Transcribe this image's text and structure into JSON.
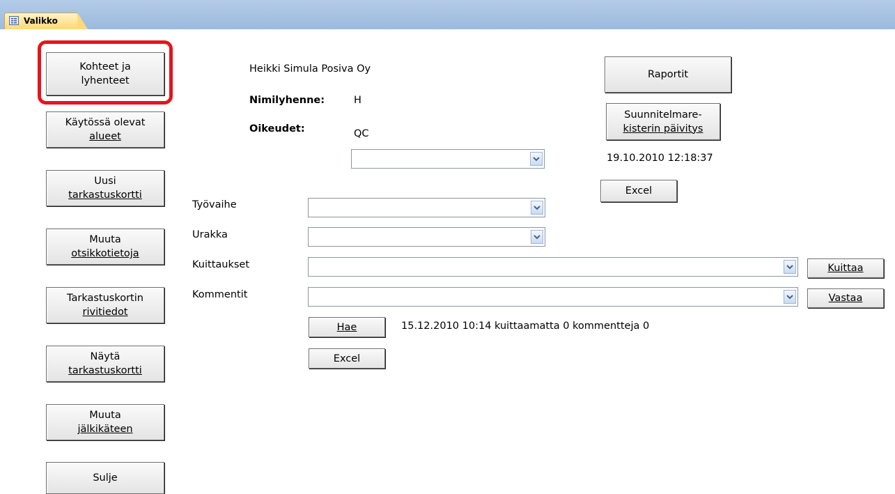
{
  "tab": {
    "label": "Valikko",
    "icon": "form-icon"
  },
  "nav_buttons": [
    {
      "line1": "Kohteet ja",
      "line2": "lyhenteet"
    },
    {
      "line1": "Käytössä olevat",
      "line2": "alueet"
    },
    {
      "line1": "Uusi",
      "line2": "tarkastuskortti"
    },
    {
      "line1": "Muuta",
      "line2": "otsikkotietoja"
    },
    {
      "line1": "Tarkastuskortin",
      "line2": "rivitiedot"
    },
    {
      "line1": "Näytä",
      "line2": "tarkastuskortti"
    },
    {
      "line1": "Muuta",
      "line2": "jälkikäteen"
    },
    {
      "line1": "Sulje",
      "line2": ""
    }
  ],
  "user": {
    "name_company": "Heikki Simula Posiva Oy",
    "abbrev_label": "Nimilyhenne:",
    "abbrev_value": "H",
    "rights_label": "Oikeudet:",
    "rights_value": "QC"
  },
  "right_panel": {
    "reports_label": "Raportit",
    "plan_update_line1": "Suunnitelmare-",
    "plan_update_line2": "kisterin päivitys",
    "timestamp": "19.10.2010 12:18:37",
    "excel_label": "Excel"
  },
  "filters": {
    "tyovaihe_label": "Työvaihe",
    "urakka_label": "Urakka",
    "kuittaukset_label": "Kuittaukset",
    "kommentit_label": "Kommentit",
    "kuittaa_label": "Kuittaa",
    "vastaa_label": "Vastaa",
    "hae_label": "Hae",
    "status": "15.12.2010 10:14 kuittaamatta 0 kommentteja 0",
    "excel_label": "Excel"
  },
  "colors": {
    "highlight": "#e8141a",
    "tab_active": "#ffd97a",
    "tabbar": "#a9c3e3"
  }
}
